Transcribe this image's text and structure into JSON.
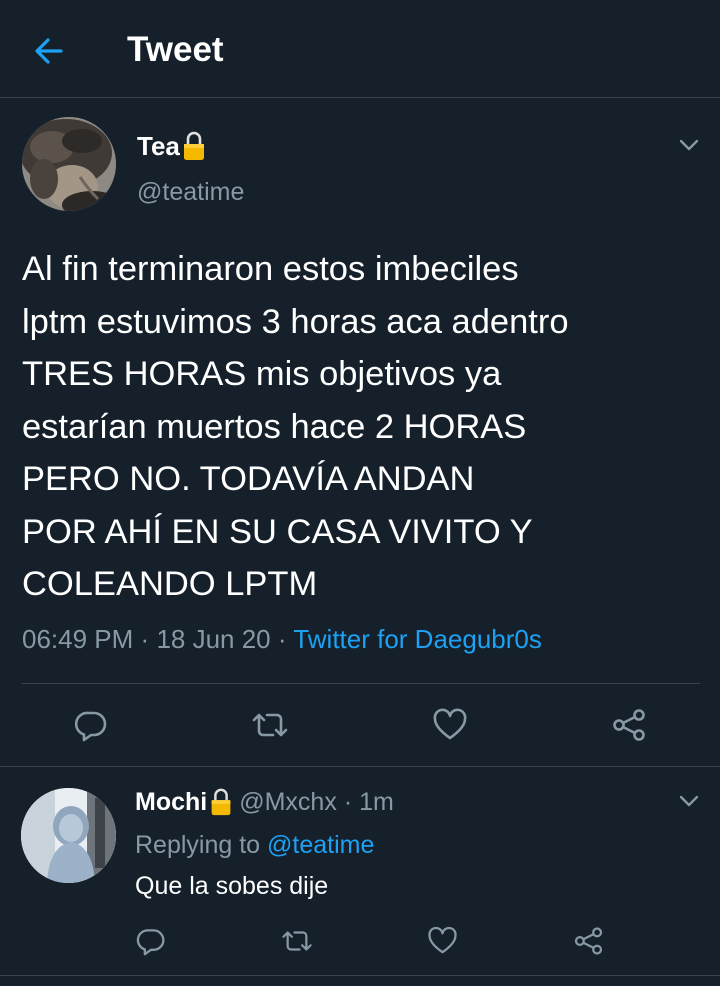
{
  "header": {
    "title": "Tweet",
    "back_icon": "arrow-left-icon",
    "accent": "#1da1f2"
  },
  "main_tweet": {
    "display_name": "Tea",
    "handle": "@teatime",
    "protected_icon": "lock-icon",
    "text": "Al fin terminaron estos imbeciles\nlptm estuvimos 3 horas aca adentro\nTRES HORAS mis objetivos ya\nestarían muertos hace 2 HORAS\nPERO NO. TODAVÍA ANDAN\nPOR AHÍ EN SU CASA VIVITO Y\nCOLEANDO LPTM",
    "time": "06:49 PM",
    "date": "18 Jun 20",
    "source": "Twitter for Daegubr0s",
    "separator": "·",
    "actions": [
      "reply-icon",
      "retweet-icon",
      "like-icon",
      "share-icon"
    ]
  },
  "reply": {
    "display_name": "Mochi",
    "handle": "@Mxchx",
    "separator": "·",
    "time": "1m",
    "replying_prefix": "Replying to",
    "replying_to": "@teatime",
    "text": "Que la sobes dije",
    "actions": [
      "reply-icon",
      "retweet-icon",
      "like-icon",
      "share-icon"
    ]
  },
  "colors": {
    "background": "#15202b",
    "divider": "#38444d",
    "secondary_text": "#8899a6",
    "link": "#1da1f2",
    "lock": "#f5b800"
  }
}
